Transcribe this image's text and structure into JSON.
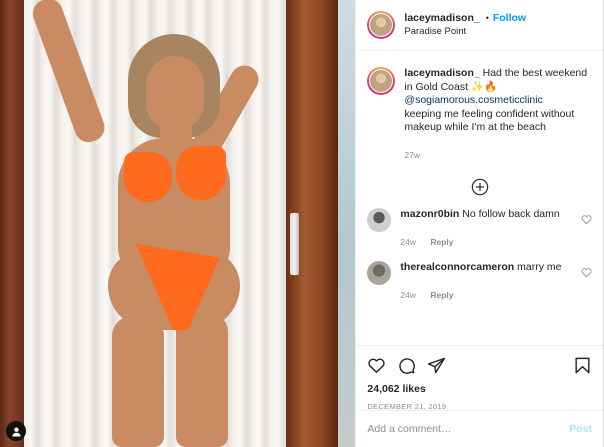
{
  "header": {
    "username": "laceymadison_",
    "dot": "•",
    "follow_label": "Follow",
    "location": "Paradise Point"
  },
  "caption": {
    "username": "laceymadison_",
    "text_1": "Had the best weekend in Gold Coast ✨🔥",
    "mention": "@sogiamorous.cosmeticclinic",
    "text_2": "keeping me feeling confident without makeup while I'm at the beach",
    "time": "27w"
  },
  "comments": [
    {
      "username": "mazonr0bin",
      "text": "No follow back damn",
      "time": "24w",
      "reply": "Reply"
    },
    {
      "username": "therealconnorcameron",
      "text": "marry me",
      "time": "24w",
      "reply": "Reply"
    }
  ],
  "likes": "24,062 likes",
  "date": "DECEMBER 21, 2019",
  "add_comment": {
    "placeholder": "Add a comment…",
    "post_label": "Post"
  },
  "colors": {
    "link_blue": "#0095f6",
    "mention": "#00376b",
    "muted": "#8e8e8e",
    "post_disabled": "#b2dffc",
    "bikini": "#ff6a1c"
  },
  "icons": [
    "user-tag-icon",
    "load-more-comments-icon",
    "like-icon",
    "comment-icon",
    "share-icon",
    "bookmark-icon",
    "comment-like-icon"
  ]
}
